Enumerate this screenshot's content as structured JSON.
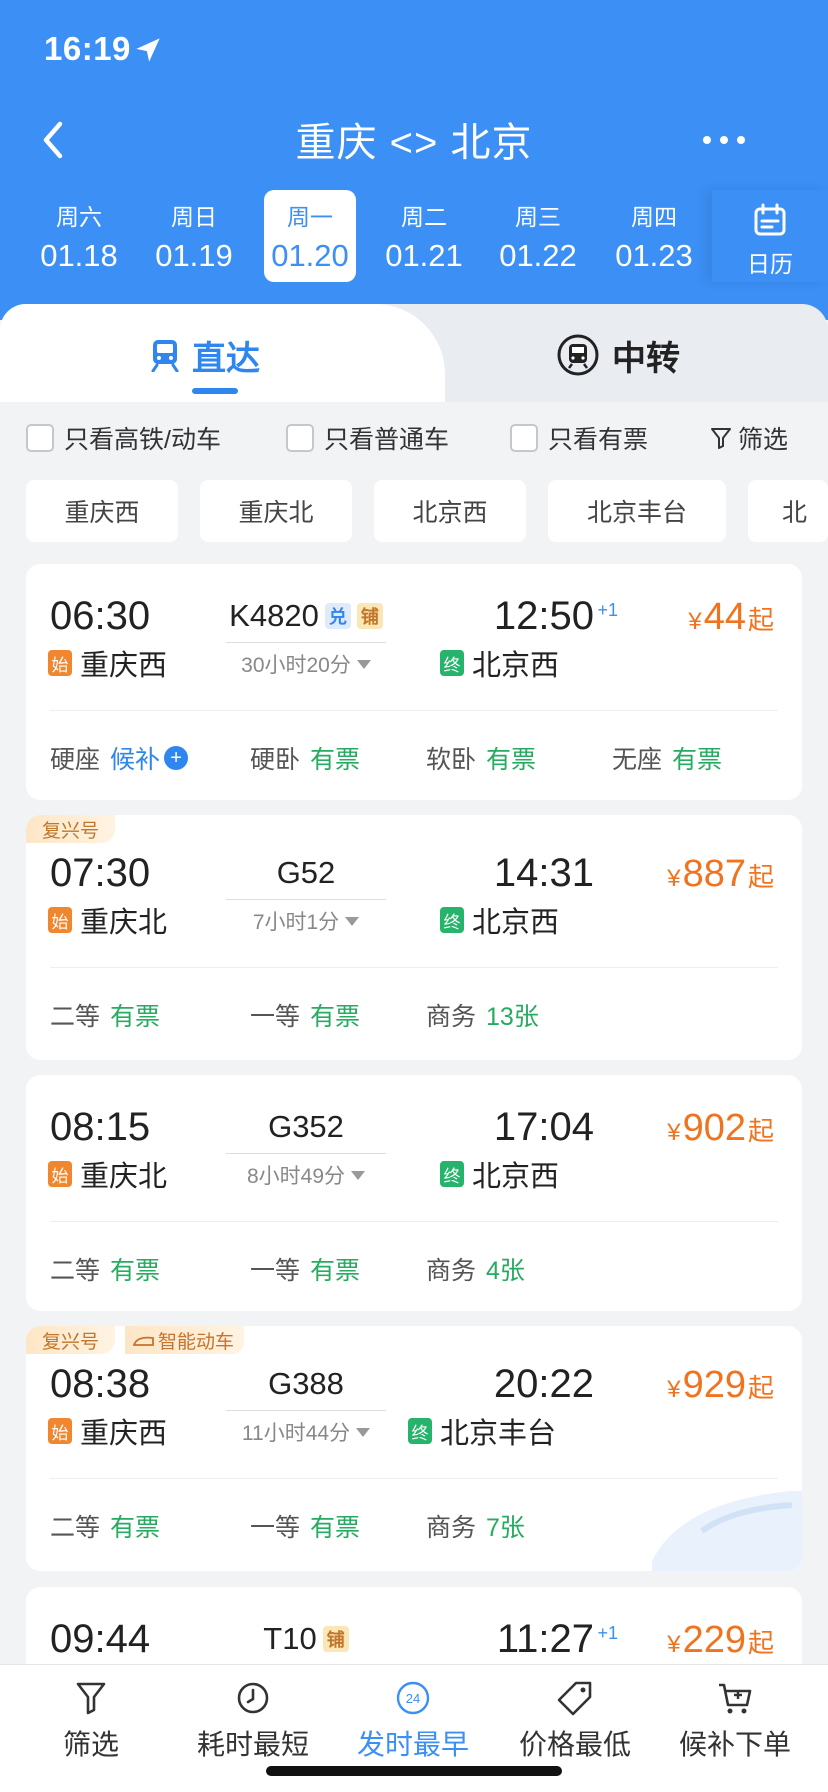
{
  "status_bar": {
    "time": "16:19"
  },
  "header": {
    "title": "重庆 <> 北京"
  },
  "dates": [
    {
      "weekday": "周六",
      "date": "01.18",
      "active": false
    },
    {
      "weekday": "周日",
      "date": "01.19",
      "active": false
    },
    {
      "weekday": "周一",
      "date": "01.20",
      "active": true
    },
    {
      "weekday": "周二",
      "date": "01.21",
      "active": false
    },
    {
      "weekday": "周三",
      "date": "01.22",
      "active": false
    },
    {
      "weekday": "周四",
      "date": "01.23",
      "active": false
    }
  ],
  "calendar": {
    "label": "日历"
  },
  "tabs": {
    "direct": "直达",
    "transfer": "中转"
  },
  "filters": {
    "high_speed": "只看高铁/动车",
    "normal": "只看普通车",
    "available": "只看有票",
    "filter_link": "筛选"
  },
  "stations": [
    "重庆西",
    "重庆北",
    "北京西",
    "北京丰台",
    "北"
  ],
  "trains": [
    {
      "tags": [],
      "dep_time": "06:30",
      "train_no": "K4820",
      "badges": [
        "兑",
        "铺"
      ],
      "duration": "30小时20分",
      "arr_time": "12:50",
      "next_day": "+1",
      "price": "44",
      "yen": "¥",
      "qi": "起",
      "dep_station": "重庆西",
      "dep_badge": "始",
      "arr_station": "北京西",
      "arr_badge": "终",
      "seats": [
        {
          "type": "硬座",
          "status": "候补",
          "kind": "wait"
        },
        {
          "type": "硬卧",
          "status": "有票",
          "kind": "avail"
        },
        {
          "type": "软卧",
          "status": "有票",
          "kind": "avail"
        },
        {
          "type": "无座",
          "status": "有票",
          "kind": "avail"
        }
      ]
    },
    {
      "tags": [
        "复兴号"
      ],
      "dep_time": "07:30",
      "train_no": "G52",
      "badges": [],
      "duration": "7小时1分",
      "arr_time": "14:31",
      "next_day": "",
      "price": "887",
      "yen": "¥",
      "qi": "起",
      "dep_station": "重庆北",
      "dep_badge": "始",
      "arr_station": "北京西",
      "arr_badge": "终",
      "seats": [
        {
          "type": "二等",
          "status": "有票",
          "kind": "avail"
        },
        {
          "type": "一等",
          "status": "有票",
          "kind": "avail"
        },
        {
          "type": "商务",
          "status": "13张",
          "kind": "avail"
        }
      ]
    },
    {
      "tags": [],
      "dep_time": "08:15",
      "train_no": "G352",
      "badges": [],
      "duration": "8小时49分",
      "arr_time": "17:04",
      "next_day": "",
      "price": "902",
      "yen": "¥",
      "qi": "起",
      "dep_station": "重庆北",
      "dep_badge": "始",
      "arr_station": "北京西",
      "arr_badge": "终",
      "seats": [
        {
          "type": "二等",
          "status": "有票",
          "kind": "avail"
        },
        {
          "type": "一等",
          "status": "有票",
          "kind": "avail"
        },
        {
          "type": "商务",
          "status": "4张",
          "kind": "avail"
        }
      ]
    },
    {
      "tags": [
        "复兴号",
        "智能动车"
      ],
      "dep_time": "08:38",
      "train_no": "G388",
      "badges": [],
      "duration": "11小时44分",
      "arr_time": "20:22",
      "next_day": "",
      "price": "929",
      "yen": "¥",
      "qi": "起",
      "dep_station": "重庆西",
      "dep_badge": "始",
      "arr_station": "北京丰台",
      "arr_badge": "终",
      "seats": [
        {
          "type": "二等",
          "status": "有票",
          "kind": "avail"
        },
        {
          "type": "一等",
          "status": "有票",
          "kind": "avail"
        },
        {
          "type": "商务",
          "status": "7张",
          "kind": "avail"
        }
      ]
    },
    {
      "tags": [],
      "dep_time": "09:44",
      "train_no": "T10",
      "badges": [
        "铺"
      ],
      "duration": "",
      "arr_time": "11:27",
      "next_day": "+1",
      "price": "229",
      "yen": "¥",
      "qi": "起",
      "dep_station": "",
      "dep_badge": "",
      "arr_station": "",
      "arr_badge": "",
      "seats": []
    }
  ],
  "bottom_bar": [
    {
      "label": "筛选",
      "icon": "filter-icon",
      "active": false
    },
    {
      "label": "耗时最短",
      "icon": "clock-icon",
      "active": false
    },
    {
      "label": "发时最早",
      "icon": "24h-icon",
      "icon_text": "24",
      "active": true
    },
    {
      "label": "价格最低",
      "icon": "price-tag-icon",
      "active": false
    },
    {
      "label": "候补下单",
      "icon": "cart-icon",
      "active": false
    }
  ],
  "colors": {
    "primary": "#3b8ff5",
    "price": "#f0741f",
    "available": "#27ab60",
    "waitlist": "#2f86ee",
    "start_badge": "#f0862e",
    "end_badge": "#26b36b"
  }
}
